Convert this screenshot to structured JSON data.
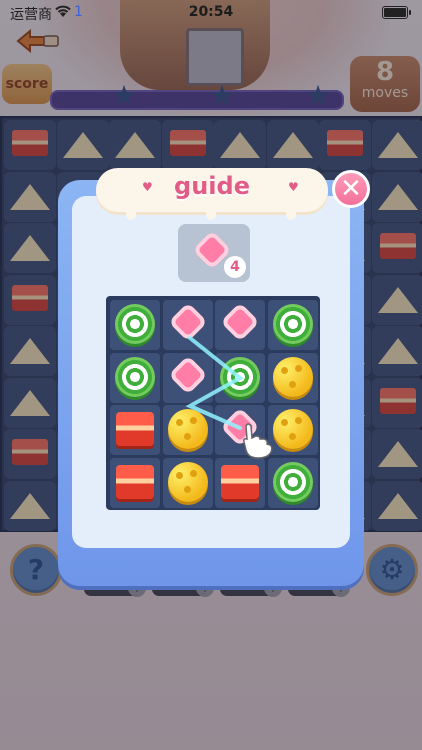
{
  "status_bar": {
    "carrier": "运营商",
    "sim": "1",
    "time": "20:54"
  },
  "hud": {
    "score_label": "score",
    "moves_count": "8",
    "moves_label": "moves",
    "stars": 3
  },
  "dialog": {
    "title": "guide",
    "close_symbol": "✕",
    "goal_count": "4"
  },
  "controls": {
    "help_symbol": "?",
    "settings_symbol": "⚙"
  },
  "mini_board": [
    [
      "green-swirl",
      "pink-heart",
      "pink-heart",
      "green-swirl"
    ],
    [
      "green-swirl",
      "pink-heart",
      "green-swirl",
      "cheese"
    ],
    [
      "red-cake",
      "cheese",
      "pink-heart",
      "cheese"
    ],
    [
      "red-cake",
      "cheese",
      "red-cake",
      "green-swirl"
    ]
  ],
  "colors": {
    "accent_pink": "#e35c88",
    "dialog_blue": "#7aa3ee",
    "board_navy": "#2c3b5b"
  }
}
